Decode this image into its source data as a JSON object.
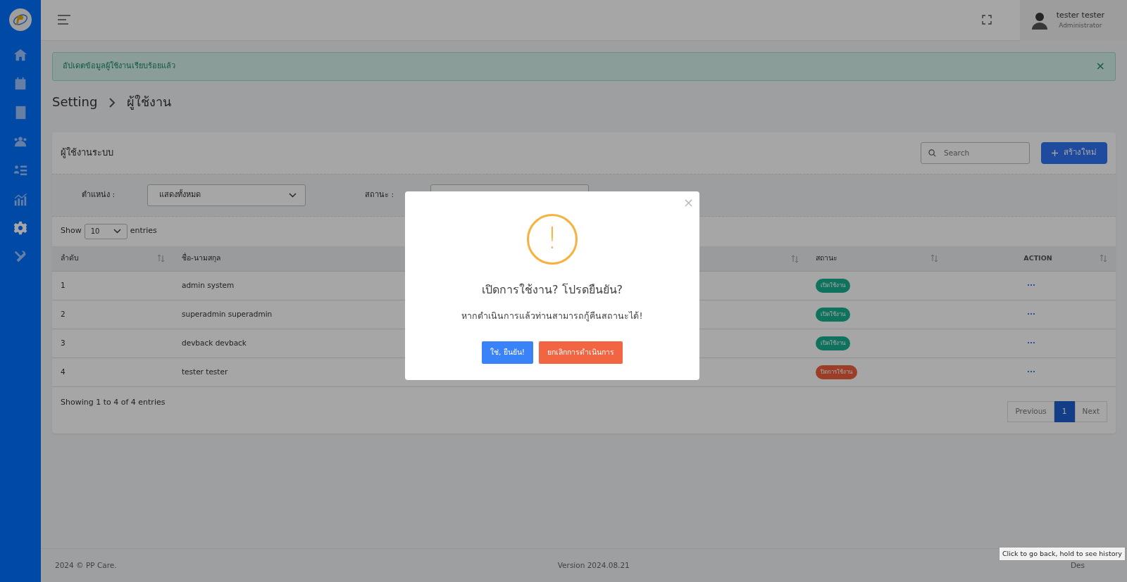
{
  "sidebar": {
    "items": [
      {
        "selected": false
      },
      {
        "selected": false
      },
      {
        "selected": false
      },
      {
        "selected": false
      },
      {
        "selected": false
      },
      {
        "selected": false
      },
      {
        "selected": true
      },
      {
        "selected": false
      }
    ]
  },
  "topbar": {
    "user_name": "tester tester",
    "user_role": "Administrator"
  },
  "alert": {
    "text": "อัปเดตข้อมูลผู้ใช้งานเรียบร้อยแล้ว",
    "close": "×"
  },
  "breadcrumb": [
    "Setting",
    "ผู้ใช้งาน"
  ],
  "card": {
    "title": "ผู้ใช้งานระบบ",
    "search": {
      "placeholder": "Search"
    },
    "create_button": "สร้างใหม่",
    "filters": [
      {
        "label": "ตำแหน่ง :",
        "value": "แสดงทั้งหมด"
      },
      {
        "label": "สถานะ :"
      }
    ],
    "length": {
      "before": "Show",
      "value": "10",
      "after": "entries"
    },
    "table": {
      "columns": [
        {
          "label": "ลำดับ"
        },
        {
          "label": "ชื่อ-นามสกุล"
        },
        {},
        {
          "label": "สถานะ"
        },
        {
          "label": "ACTION"
        }
      ],
      "rows": [
        {
          "number": "1",
          "name": "admin system",
          "status": "เปิดใช้งาน",
          "active": true,
          "action": "···"
        },
        {
          "number": "2",
          "name": "superadmin superadmin",
          "status": "เปิดใช้งาน",
          "active": true,
          "action": "···"
        },
        {
          "number": "3",
          "name": "devback devback",
          "status": "เปิดใช้งาน",
          "active": true,
          "action": "···"
        },
        {
          "number": "4",
          "name": "tester tester",
          "status": "ปิดการใช้งาน",
          "active": false,
          "action": "···"
        }
      ]
    },
    "info": "Showing 1 to 4 of 4 entries",
    "pagination": [
      {
        "label": "Previous",
        "selected": false
      },
      {
        "label": "1",
        "selected": true
      },
      {
        "label": "Next",
        "selected": false
      }
    ]
  },
  "footer": {
    "left": "2024 © PP Care.",
    "center": "Version 2024.08.21",
    "right": "Des"
  },
  "modal": {
    "icon": "!",
    "title": "เปิดการใช้งาน? โปรดยืนยัน?",
    "text": "หากดำเนินการแล้วท่านสามารถกู้คืนสถานะได้!",
    "confirm": "ใช่, ยืนยัน!",
    "cancel": "ยกเลิกการดำเนินการ",
    "close": "×"
  },
  "tooltip": "Click to go back, hold to see history"
}
